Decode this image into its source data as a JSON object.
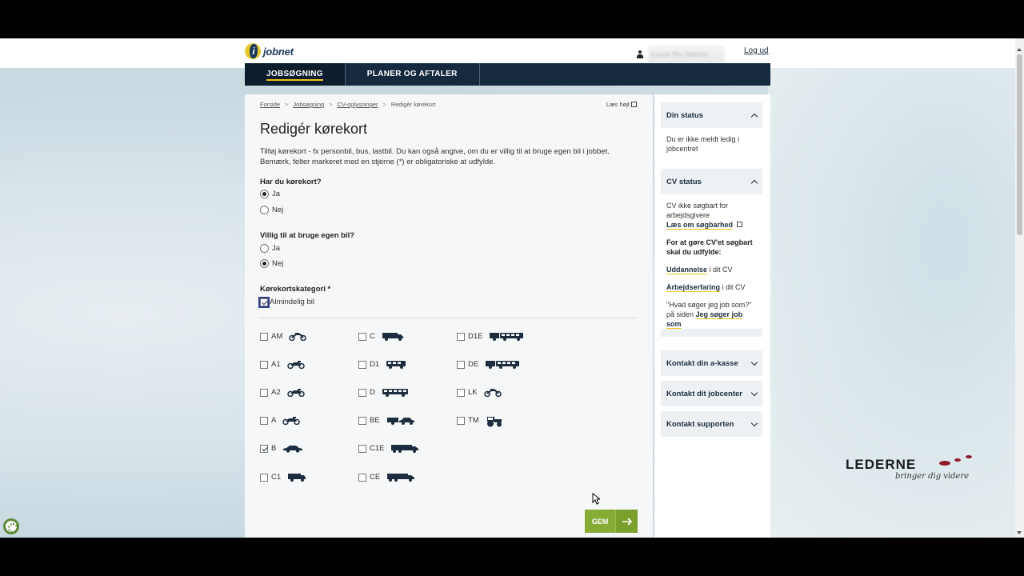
{
  "header": {
    "logo_text": "jobnet",
    "user_name": "Lasse Rix Nielsen",
    "logout_label": "Log ud"
  },
  "nav": {
    "tabs": [
      {
        "label": "JOBSØGNING",
        "active": true
      },
      {
        "label": "PLANER OG AFTALER",
        "active": false
      }
    ]
  },
  "breadcrumb": {
    "items": [
      "Forside",
      "Jobsøgning",
      "CV-oplysninger"
    ],
    "current": "Redigér kørekort",
    "separator": ">"
  },
  "read_aloud_label": "Læs højt",
  "page_title": "Redigér kørekort",
  "intro_text": "Tilføj kørekort - fx personbil, bus, lastbil. Du kan også angive, om du er villig til at bruge egen bil i jobbet. Bemærk, felter markeret med en stjerne (*) er obligatoriske at udfylde.",
  "question_license": {
    "label": "Har du kørekort?",
    "options": [
      {
        "label": "Ja",
        "selected": true
      },
      {
        "label": "Nej",
        "selected": false
      }
    ]
  },
  "question_own_car": {
    "label": "Villig til at bruge egen bil?",
    "options": [
      {
        "label": "Ja",
        "selected": false
      },
      {
        "label": "Nej",
        "selected": true
      }
    ]
  },
  "category_section": {
    "label": "Kørekortskategori *",
    "general_option": {
      "label": "Almindelig bil",
      "checked": true
    },
    "categories": [
      {
        "code": "AM",
        "checked": false,
        "icon": "moped-icon"
      },
      {
        "code": "A1",
        "checked": false,
        "icon": "motorcycle-icon"
      },
      {
        "code": "A2",
        "checked": false,
        "icon": "motorcycle-icon"
      },
      {
        "code": "A",
        "checked": false,
        "icon": "motorcycle-icon"
      },
      {
        "code": "B",
        "checked": true,
        "icon": "car-icon"
      },
      {
        "code": "C1",
        "checked": false,
        "icon": "van-icon"
      },
      {
        "code": "C",
        "checked": false,
        "icon": "truck-icon"
      },
      {
        "code": "D1",
        "checked": false,
        "icon": "minibus-icon"
      },
      {
        "code": "D",
        "checked": false,
        "icon": "bus-icon"
      },
      {
        "code": "BE",
        "checked": false,
        "icon": "car-trailer-icon"
      },
      {
        "code": "C1E",
        "checked": false,
        "icon": "truck-trailer-icon"
      },
      {
        "code": "CE",
        "checked": false,
        "icon": "truck-trailer-icon"
      },
      {
        "code": "D1E",
        "checked": false,
        "icon": "bus-trailer-icon"
      },
      {
        "code": "DE",
        "checked": false,
        "icon": "bus-trailer-icon"
      },
      {
        "code": "LK",
        "checked": false,
        "icon": "moped-icon"
      },
      {
        "code": "TM",
        "checked": false,
        "icon": "tractor-icon"
      }
    ]
  },
  "save_button": {
    "label": "GEM"
  },
  "sidebar": {
    "status": {
      "title": "Din status",
      "text": "Du er ikke meldt ledig i jobcentret"
    },
    "cv_status": {
      "title": "CV status",
      "text": "CV ikke søgbart for arbejdsgivere",
      "link": "Læs om søgbarhed",
      "requirement_heading": "For at gøre CV'et søgbart skal du udfylde:",
      "items": [
        {
          "link": "Uddannelse",
          "suffix": "i dit CV"
        },
        {
          "link": "Arbejdserfaring",
          "suffix": "i dit CV"
        }
      ],
      "search_text": "\"Hvad søger jeg job som?\" på siden",
      "search_link": "Jeg søger job som"
    },
    "contacts": [
      {
        "label": "Kontakt din a-kasse"
      },
      {
        "label": "Kontakt dit jobcenter"
      },
      {
        "label": "Kontakt supporten"
      }
    ]
  },
  "watermark": {
    "name": "LEDERNE",
    "tagline": "bringer dig videre"
  },
  "colors": {
    "nav_bg": "#162a3f",
    "accent": "#ecc31a",
    "save_button": "#86ac36"
  }
}
